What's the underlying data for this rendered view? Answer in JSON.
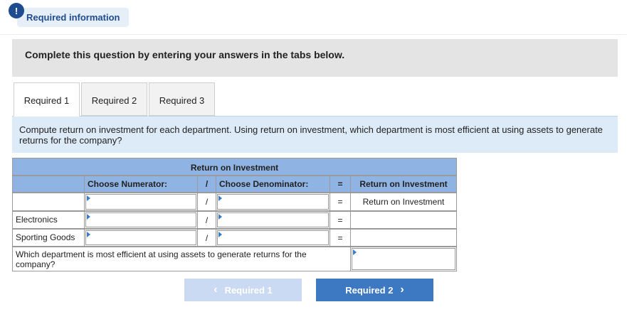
{
  "header": {
    "info_icon_glyph": "!",
    "required_info_label": "Required information"
  },
  "instructions": {
    "text": "Complete this question by entering your answers in the tabs below."
  },
  "tabs": [
    {
      "label": "Required 1",
      "active": true
    },
    {
      "label": "Required 2",
      "active": false
    },
    {
      "label": "Required 3",
      "active": false
    }
  ],
  "question": {
    "text": "Compute return on investment for each department. Using return on investment, which department is most efficient at using assets to generate returns for the company?"
  },
  "table": {
    "title": "Return on Investment",
    "header": {
      "numerator": "Choose Numerator:",
      "div": "/",
      "denominator": "Choose Denominator:",
      "eq": "=",
      "result": "Return on Investment"
    },
    "formula_row": {
      "numerator_value": "",
      "div": "/",
      "denominator_value": "",
      "eq": "=",
      "result": "Return on Investment"
    },
    "rows": [
      {
        "label": "Electronics",
        "numerator_value": "",
        "div": "/",
        "denominator_value": "",
        "eq": "=",
        "result": ""
      },
      {
        "label": "Sporting Goods",
        "numerator_value": "",
        "div": "/",
        "denominator_value": "",
        "eq": "=",
        "result": ""
      }
    ],
    "efficient_question": "Which department is most efficient at using assets to generate returns for the company?",
    "efficient_answer": ""
  },
  "nav": {
    "prev_label": "Required 1",
    "prev_glyph": "‹",
    "next_label": "Required 2",
    "next_glyph": "›"
  },
  "colors": {
    "accent": "#1e4c8e",
    "table_header": "#8fb4e3",
    "next_button": "#3d78c2",
    "prev_button_disabled": "#c9daf2"
  }
}
